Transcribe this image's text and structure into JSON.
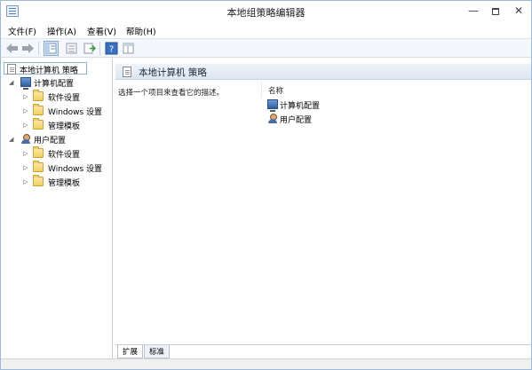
{
  "window": {
    "title": "本地组策略编辑器",
    "minimize_glyph": "—",
    "close_glyph": "✕"
  },
  "menu": {
    "items": [
      "文件(F)",
      "操作(A)",
      "查看(V)",
      "帮助(H)"
    ]
  },
  "toolbar": {
    "icons": [
      "back-arrow-icon",
      "forward-arrow-icon",
      "show-tree-icon",
      "properties-icon",
      "export-list-icon",
      "help-icon",
      "view-icon"
    ]
  },
  "tree": {
    "root": "本地计算机 策略",
    "nodes": [
      {
        "label": "计算机配置",
        "children": [
          "软件设置",
          "Windows 设置",
          "管理模板"
        ]
      },
      {
        "label": "用户配置",
        "children": [
          "软件设置",
          "Windows 设置",
          "管理模板"
        ]
      }
    ]
  },
  "details": {
    "title": "本地计算机 策略",
    "description": "选择一个项目来查看它的描述。",
    "column_name": "名称",
    "items": [
      "计算机配置",
      "用户配置"
    ]
  },
  "tabs": [
    "扩展",
    "标准"
  ],
  "colors": {
    "accent": "#8eb1d8",
    "header_bg": "#dde6f1",
    "folder": "#f1cf63"
  }
}
